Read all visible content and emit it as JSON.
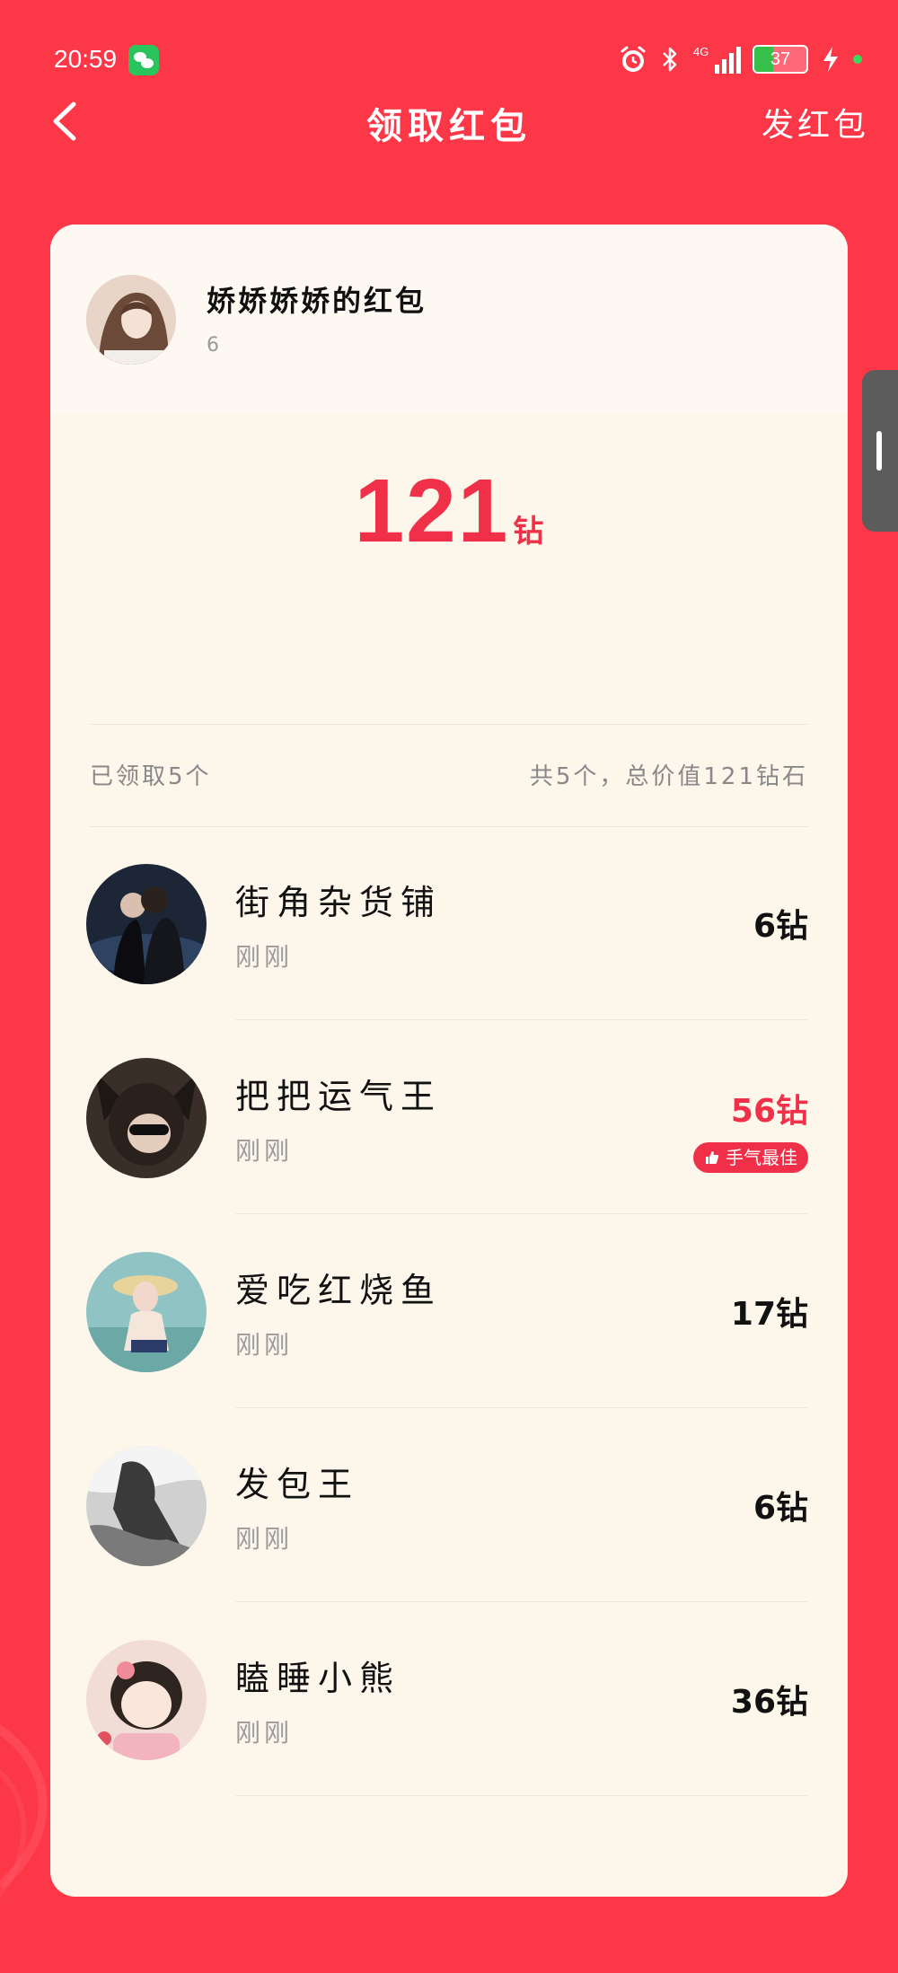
{
  "status_bar": {
    "time": "20:59",
    "network": "4G",
    "battery_level": "37",
    "battery_fraction": 0.37
  },
  "nav": {
    "title": "领取红包",
    "action": "发红包"
  },
  "envelope": {
    "sender_name": "娇娇娇娇的红包",
    "sender_sub": "6",
    "amount": "121",
    "unit": "钻"
  },
  "summary": {
    "claimed": "已领取5个",
    "total": "共5个，总价值121钻石"
  },
  "recipients": [
    {
      "name": "街角杂货铺",
      "time": "刚刚",
      "amount": "6钻",
      "best": false
    },
    {
      "name": "把把运气王",
      "time": "刚刚",
      "amount": "56钻",
      "best": true,
      "badge": "手气最佳"
    },
    {
      "name": "爱吃红烧鱼",
      "time": "刚刚",
      "amount": "17钻",
      "best": false
    },
    {
      "name": "发包王",
      "time": "刚刚",
      "amount": "6钻",
      "best": false
    },
    {
      "name": "瞌睡小熊",
      "time": "刚刚",
      "amount": "36钻",
      "best": false
    }
  ],
  "colors": {
    "background": "#FC3748",
    "accent": "#F03048",
    "card": "#FCF6EB"
  }
}
